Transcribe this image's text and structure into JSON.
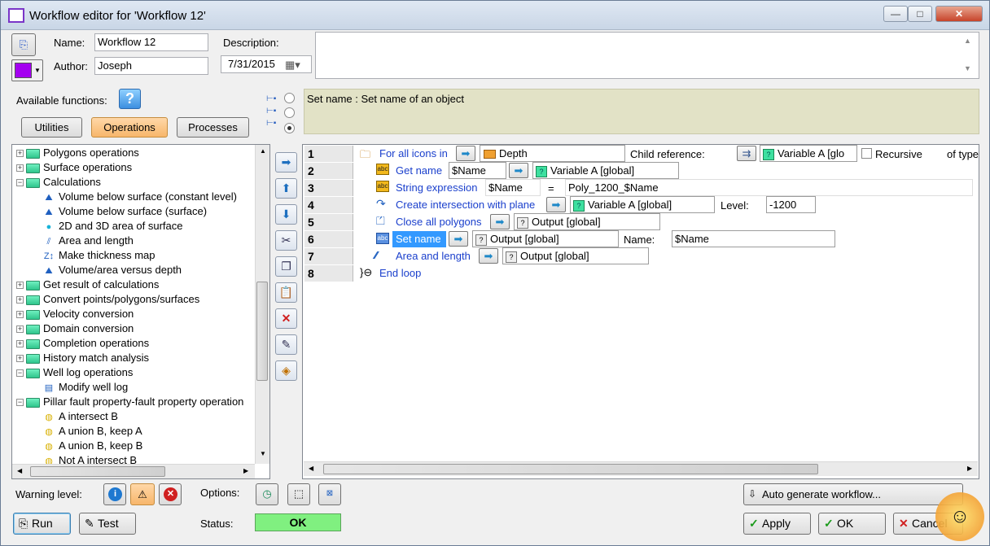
{
  "window": {
    "title": "Workflow editor for 'Workflow 12'",
    "minimize": "—",
    "maximize": "□",
    "close": "✕"
  },
  "header": {
    "name_label": "Name:",
    "name_value": "Workflow 12",
    "author_label": "Author:",
    "author_value": "Joseph",
    "description_label": "Description:",
    "date_value": "7/31/2015",
    "accent_color": "#a400f0"
  },
  "functions": {
    "label": "Available functions:",
    "help": "?",
    "tabs": [
      "Utilities",
      "Operations",
      "Processes"
    ],
    "active_tab": "Operations",
    "tree": [
      {
        "label": "Polygons operations",
        "type": "folder",
        "exp": "+"
      },
      {
        "label": "Surface operations",
        "type": "folder",
        "exp": "+"
      },
      {
        "label": "Calculations",
        "type": "folder",
        "exp": "−"
      },
      {
        "label": "Volume below surface (constant level)",
        "type": "leaf",
        "icon": "volume-icon"
      },
      {
        "label": "Volume below surface (surface)",
        "type": "leaf",
        "icon": "volume-icon"
      },
      {
        "label": "2D and 3D area of surface",
        "type": "leaf",
        "icon": "area-icon"
      },
      {
        "label": "Area and length",
        "type": "leaf",
        "icon": "lines-icon"
      },
      {
        "label": "Make thickness map",
        "type": "leaf",
        "icon": "thickness-icon"
      },
      {
        "label": "Volume/area versus depth",
        "type": "leaf",
        "icon": "volume-icon"
      },
      {
        "label": "Get result of calculations",
        "type": "folder",
        "exp": "+"
      },
      {
        "label": "Convert points/polygons/surfaces",
        "type": "folder",
        "exp": "+"
      },
      {
        "label": "Velocity conversion",
        "type": "folder",
        "exp": "+"
      },
      {
        "label": "Domain conversion",
        "type": "folder",
        "exp": "+"
      },
      {
        "label": "Completion operations",
        "type": "folder",
        "exp": "+"
      },
      {
        "label": "History match analysis",
        "type": "folder",
        "exp": "+"
      },
      {
        "label": "Well log operations",
        "type": "folder",
        "exp": "−"
      },
      {
        "label": "Modify well log",
        "type": "leaf",
        "icon": "welllog-icon"
      },
      {
        "label": "Pillar fault property-fault property operation",
        "type": "folder",
        "exp": "−"
      },
      {
        "label": "A intersect B",
        "type": "leaf",
        "icon": "venn-icon"
      },
      {
        "label": "A union B, keep A",
        "type": "leaf",
        "icon": "venn-icon"
      },
      {
        "label": "A union B, keep B",
        "type": "leaf",
        "icon": "venn-icon"
      },
      {
        "label": "Not A intersect B",
        "type": "leaf",
        "icon": "venn-icon"
      }
    ]
  },
  "info_text": "Set name : Set name of an object",
  "workflow": {
    "rows": [
      "1",
      "2",
      "3",
      "4",
      "5",
      "6",
      "7",
      "8"
    ],
    "r1": {
      "cmd": "For all icons in",
      "target": "Depth",
      "child_label": "Child reference:",
      "child_value": "Variable A [glo",
      "recursive": "Recursive",
      "of_type": "of type"
    },
    "r2": {
      "cmd": "Get name",
      "arg": "$Name",
      "value": "Variable A [global]"
    },
    "r3": {
      "cmd": "String expression",
      "arg": "$Name",
      "eq": "=",
      "expr": "Poly_1200_$Name"
    },
    "r4": {
      "cmd": "Create intersection with plane",
      "value": "Variable A [global]",
      "level_label": "Level:",
      "level_value": "-1200"
    },
    "r5": {
      "cmd": "Close all polygons",
      "value": "Output [global]"
    },
    "r6": {
      "cmd": "Set name",
      "value": "Output [global]",
      "name_label": "Name:",
      "name_value": "$Name"
    },
    "r7": {
      "cmd": "Area and length",
      "value": "Output [global]"
    },
    "r8": {
      "cmd": "End loop"
    }
  },
  "footer": {
    "warning_label": "Warning level:",
    "options_label": "Options:",
    "status_label": "Status:",
    "status_value": "OK",
    "auto_generate": "Auto generate workflow...",
    "run": "Run",
    "test": "Test",
    "apply": "Apply",
    "ok": "OK",
    "cancel": "Cancel",
    "status_color": "#80f080"
  }
}
